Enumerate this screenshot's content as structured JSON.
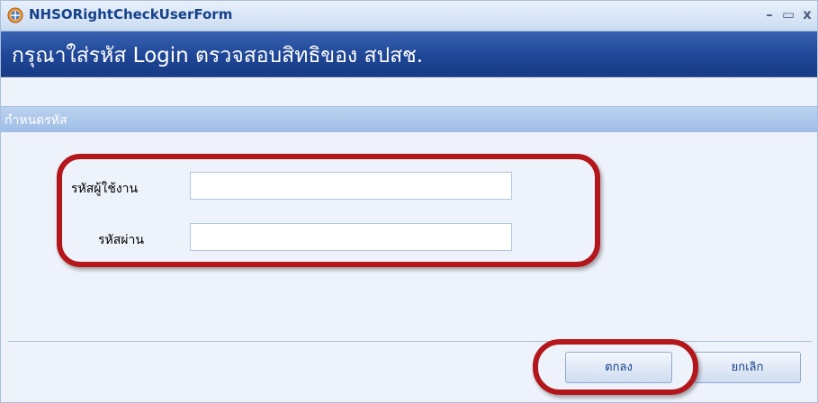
{
  "window": {
    "title": "NHSORightCheckUserForm",
    "minimize_glyph": "–",
    "maximize_glyph": "▭",
    "close_glyph": "x"
  },
  "banner": {
    "text": "กรุณาใส่รหัส Login ตรวจสอบสิทธิของ สปสช."
  },
  "section": {
    "title": "กำหนดรหัส"
  },
  "form": {
    "username_label": "รหัสผู้ใช้งาน",
    "username_value": "",
    "password_label": "รหัสผ่าน",
    "password_value": ""
  },
  "buttons": {
    "ok_label": "ตกลง",
    "cancel_label": "ยกเลิก"
  },
  "icons": {
    "app": "nhso-app-icon",
    "minimize": "minimize-icon",
    "maximize": "maximize-icon",
    "close": "close-icon"
  },
  "colors": {
    "banner": "#1f4696",
    "annotation": "#b3161b",
    "title_text": "#15428b"
  }
}
